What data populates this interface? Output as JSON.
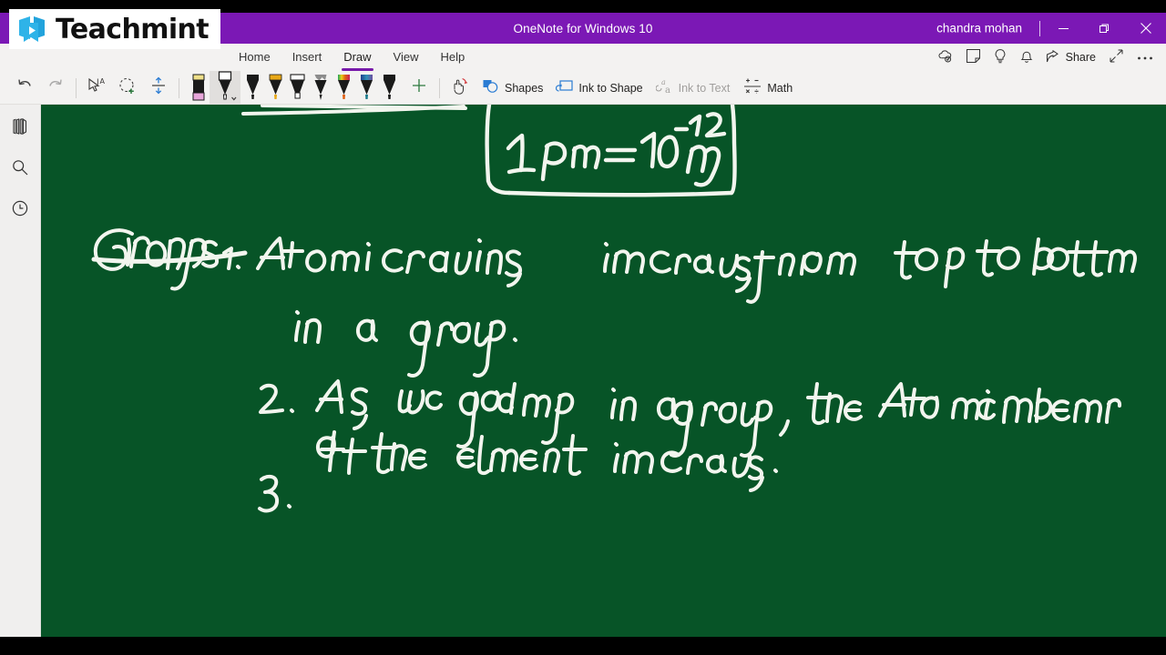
{
  "window": {
    "title": "OneNote for Windows 10",
    "user": "chandra mohan",
    "minimize_label": "—",
    "restore_label": "❐",
    "close_label": "✕"
  },
  "brand": {
    "name": "Teachmint",
    "logo_icon": "teachmint-play-book-icon",
    "accent": "#29ABE2",
    "title_bg": "#7B18B5"
  },
  "ribbon": {
    "tabs": [
      {
        "label": "Home",
        "active": false
      },
      {
        "label": "Insert",
        "active": false
      },
      {
        "label": "Draw",
        "active": true
      },
      {
        "label": "View",
        "active": false
      },
      {
        "label": "Help",
        "active": false
      }
    ],
    "right_items": [
      {
        "label": "",
        "icon": "cloud-sync-icon"
      },
      {
        "label": "",
        "icon": "sticky-note-icon"
      },
      {
        "label": "",
        "icon": "lightbulb-icon"
      },
      {
        "label": "",
        "icon": "bell-icon"
      },
      {
        "label": "Share",
        "icon": "share-icon"
      },
      {
        "label": "",
        "icon": "expand-arrows-icon"
      },
      {
        "label": "",
        "icon": "more-ellipsis-icon"
      }
    ],
    "tools": [
      {
        "name": "undo",
        "icon": "undo-arrow-icon",
        "disabled": false
      },
      {
        "name": "redo",
        "icon": "redo-arrow-icon",
        "disabled": true
      },
      {
        "name": "lasso-text-select",
        "icon": "lasso-text-icon",
        "disabled": false
      },
      {
        "name": "lasso-select",
        "icon": "lasso-select-icon",
        "disabled": false
      },
      {
        "name": "ink-space",
        "icon": "insert-space-icon",
        "disabled": false
      }
    ],
    "pens": [
      {
        "name": "eraser",
        "icon": "eraser-icon",
        "body": "#1A1A1A",
        "tip": "#E5A8D8",
        "cap": "#F2E07A",
        "selected": false,
        "type": "eraser"
      },
      {
        "name": "pen-white",
        "icon": "pen-icon",
        "body": "#1A1A1A",
        "tip": "#FFFFFF",
        "cap": "#FFFFFF",
        "selected": true,
        "type": "pen"
      },
      {
        "name": "pen-black",
        "icon": "pen-icon",
        "body": "#1A1A1A",
        "tip": "#1A1A1A",
        "cap": "#1A1A1A",
        "selected": false,
        "type": "pen"
      },
      {
        "name": "pen-yellow",
        "icon": "pen-icon",
        "body": "#1A1A1A",
        "tip": "#E8A817",
        "cap": "#E8A817",
        "selected": false,
        "type": "pen"
      },
      {
        "name": "highlighter-white",
        "icon": "highlighter-icon",
        "body": "#1A1A1A",
        "tip": "#FFFFFF",
        "cap": "#FFFFFF",
        "selected": false,
        "type": "highlighter"
      },
      {
        "name": "pencil-grey",
        "icon": "pencil-icon",
        "body": "#1A1A1A",
        "tip": "#6E6E6E",
        "cap": "#9A9A9A",
        "selected": false,
        "type": "pencil"
      },
      {
        "name": "pen-rainbow",
        "icon": "pen-icon",
        "body": "#1A1A1A",
        "tip": "#E06010",
        "cap": "rainbow",
        "selected": false,
        "type": "pen"
      },
      {
        "name": "pen-galaxy",
        "icon": "pen-icon",
        "body": "#1A1A1A",
        "tip": "#1C7A8C",
        "cap": "galaxy",
        "selected": false,
        "type": "pen"
      },
      {
        "name": "pen-dark",
        "icon": "pen-icon",
        "body": "#1A1A1A",
        "tip": "#1A1A1A",
        "cap": "#1A1A1A",
        "selected": false,
        "type": "pen"
      }
    ],
    "add_pen_label": "+",
    "commands": [
      {
        "label": "",
        "icon": "touch-draw-icon",
        "disabled": false,
        "name": "draw-with-touch"
      },
      {
        "label": "Shapes",
        "icon": "shapes-icon",
        "disabled": false,
        "name": "shapes"
      },
      {
        "label": "Ink to Shape",
        "icon": "ink-to-shape-icon",
        "disabled": false,
        "name": "ink-to-shape"
      },
      {
        "label": "Ink to Text",
        "icon": "ink-to-text-icon",
        "disabled": true,
        "name": "ink-to-text"
      },
      {
        "label": "Math",
        "icon": "math-icon",
        "disabled": false,
        "name": "math"
      }
    ]
  },
  "rail": {
    "items": [
      {
        "name": "notebooks",
        "icon": "notebooks-icon"
      },
      {
        "name": "search",
        "icon": "search-icon"
      },
      {
        "name": "recent",
        "icon": "clock-recent-icon"
      }
    ]
  },
  "canvas": {
    "background": "#075427",
    "ink_color": "#F2F5EE",
    "notes": {
      "boxed_formula": "1 pm = 10⁻¹² m",
      "heading": "Groups",
      "points": [
        {
          "number": "1.",
          "lines": [
            "Atomic  radius  increase  from  top  to  bottom",
            "in  a  group ."
          ]
        },
        {
          "number": "2.",
          "lines": [
            "As  we   go  down  in  a  group ,  the  Atomic  number",
            "of  the  element  increases ."
          ]
        },
        {
          "number": "3.",
          "lines": []
        }
      ]
    }
  }
}
